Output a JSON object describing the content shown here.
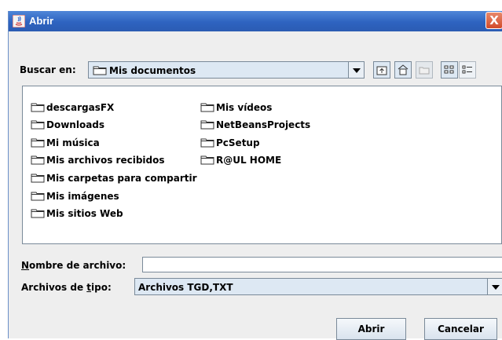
{
  "window": {
    "title": "Abrir",
    "close_label": "X"
  },
  "look_in": {
    "label": "Buscar en:",
    "value": "Mis documentos"
  },
  "toolbar": {
    "icons": [
      "up-folder-icon",
      "home-icon",
      "new-folder-icon",
      "list-view-icon",
      "details-view-icon"
    ]
  },
  "files": {
    "col1": [
      "descargasFX",
      "Downloads",
      "Mi música",
      "Mis archivos recibidos",
      "Mis carpetas para compartir",
      "Mis imágenes",
      "Mis sitios Web"
    ],
    "col2": [
      "Mis vídeos",
      "NetBeansProjects",
      "PcSetup",
      "R@UL HOME"
    ]
  },
  "filename": {
    "label_prefix": "N",
    "label_rest": "ombre de archivo:",
    "value": ""
  },
  "filetype": {
    "label_prefix": "Archivos de ",
    "label_mnemonic": "t",
    "label_rest": "ipo:",
    "value": "Archivos TGD,TXT"
  },
  "buttons": {
    "open": "Abrir",
    "cancel": "Cancelar"
  },
  "colors": {
    "titlebar": "#2e63c0",
    "panel": "#eeeeee",
    "control": "#dde8f3"
  }
}
